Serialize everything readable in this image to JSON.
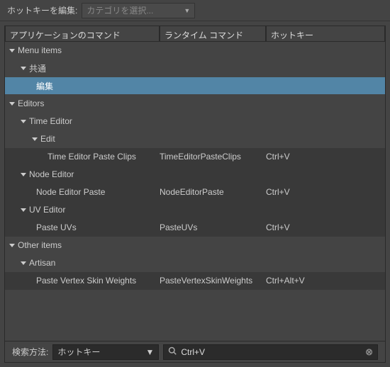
{
  "topbar": {
    "label": "ホットキーを編集:",
    "category_placeholder": "カテゴリを選択..."
  },
  "columns": {
    "c1": "アプリケーションのコマンド",
    "c2": "ランタイム コマンド",
    "c3": "ホットキー"
  },
  "tree": {
    "menu_items": "Menu items",
    "common": "共通",
    "edit_jp": "編集",
    "editors": "Editors",
    "time_editor": "Time Editor",
    "edit": "Edit",
    "te_paste_clips": {
      "name": "Time Editor Paste Clips",
      "runtime": "TimeEditorPasteClips",
      "hk": "Ctrl+V"
    },
    "node_editor": "Node Editor",
    "ne_paste": {
      "name": "Node Editor Paste",
      "runtime": "NodeEditorPaste",
      "hk": "Ctrl+V"
    },
    "uv_editor": "UV Editor",
    "paste_uvs": {
      "name": "Paste UVs",
      "runtime": "PasteUVs",
      "hk": "Ctrl+V"
    },
    "other_items": "Other items",
    "artisan": "Artisan",
    "paste_vsw": {
      "name": "Paste Vertex Skin Weights",
      "runtime": "PasteVertexSkinWeights",
      "hk": "Ctrl+Alt+V"
    }
  },
  "bottom": {
    "label": "検索方法:",
    "mode": "ホットキー",
    "query": "Ctrl+V"
  }
}
